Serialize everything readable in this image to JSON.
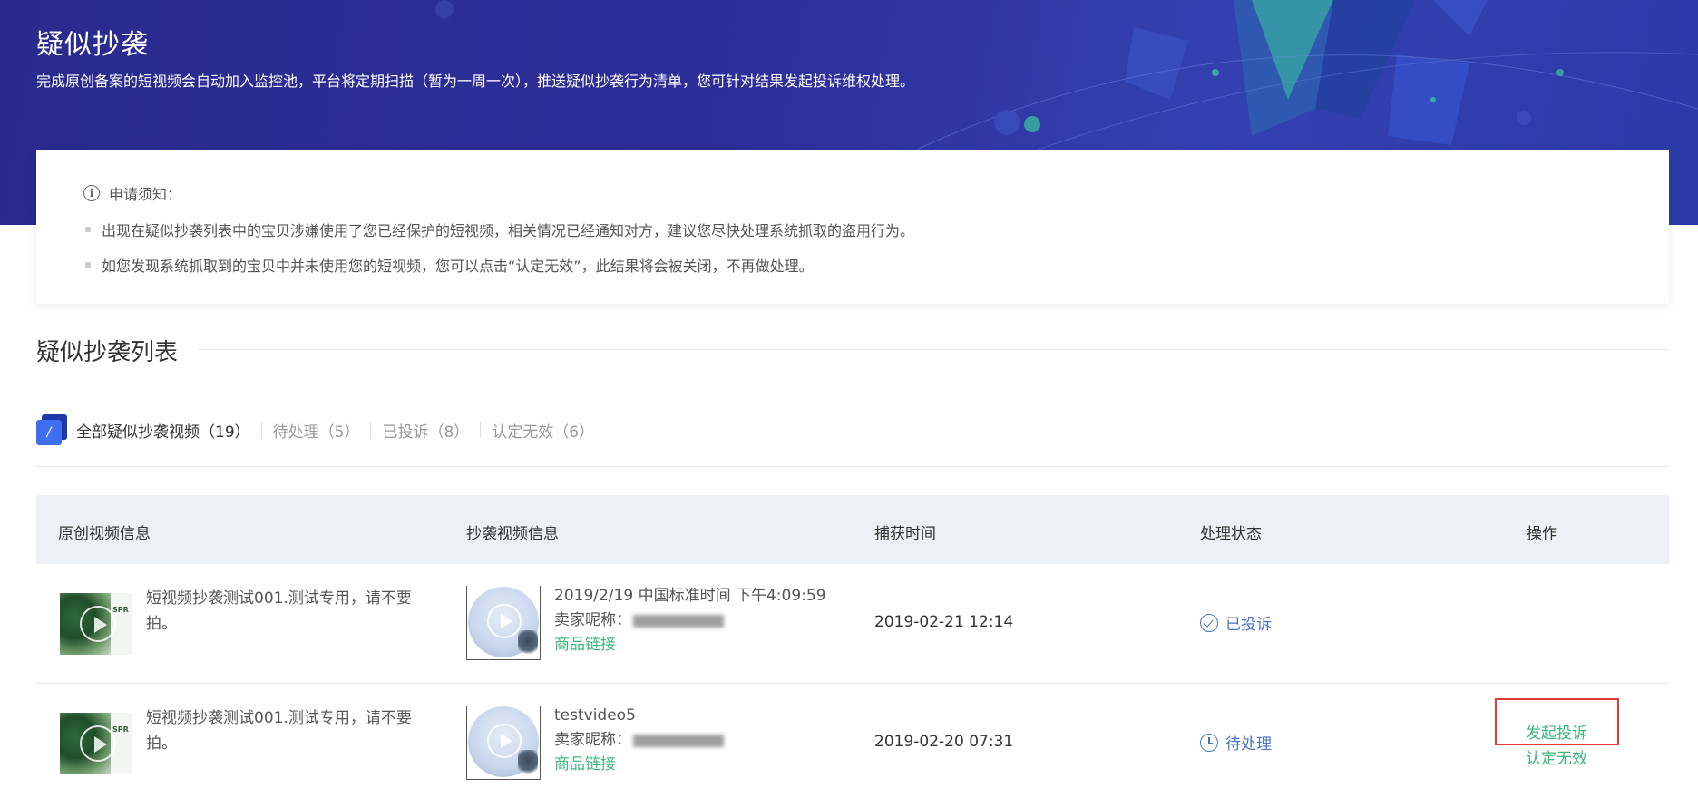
{
  "banner": {
    "title": "疑似抄袭",
    "description": "完成原创备案的短视频会自动加入监控池，平台将定期扫描（暂为一周一次），推送疑似抄袭行为清单，您可针对结果发起投诉维权处理。"
  },
  "notice": {
    "heading": "申请须知：",
    "icon": "info-icon",
    "items": [
      "出现在疑似抄袭列表中的宝贝涉嫌使用了您已经保护的短视频，相关情况已经通知对方，建议您尽快处理系统抓取的盗用行为。",
      "如您发现系统抓取到的宝贝中并未使用您的短视频，您可以点击“认定无效”，此结果将会被关闭，不再做处理。"
    ]
  },
  "section": {
    "title": "疑似抄袭列表"
  },
  "tabs": [
    {
      "label": "全部疑似抄袭视频（19）",
      "active": true
    },
    {
      "label": "待处理（5）",
      "active": false
    },
    {
      "label": "已投诉（8）",
      "active": false
    },
    {
      "label": "认定无效（6）",
      "active": false
    }
  ],
  "table": {
    "headers": [
      "原创视频信息",
      "抄袭视频信息",
      "捕获时间",
      "处理状态",
      "操作"
    ],
    "rows": [
      {
        "original_title": "短视频抄袭测试001.测试专用，请不要拍。",
        "copy_title": "2019/2/19 中国标准时间 下午4:09:59",
        "seller_label": "卖家昵称：",
        "product_link": "商品链接",
        "capture_time": "2019-02-21 12:14",
        "status": "已投诉",
        "status_icon": "check-circle-icon",
        "actions": []
      },
      {
        "original_title": "短视频抄袭测试001.测试专用，请不要拍。",
        "copy_title": "testvideo5",
        "seller_label": "卖家昵称：",
        "product_link": "商品链接",
        "capture_time": "2019-02-20 07:31",
        "status": "待处理",
        "status_icon": "clock-icon",
        "actions": [
          "发起投诉",
          "认定无效"
        ]
      }
    ]
  },
  "colors": {
    "banner": "#2d2f9a",
    "link_green": "#3bb87a",
    "status_blue": "#4a72c4",
    "highlight_red": "#e53935",
    "tab_icon_blue": "#3d6ff0"
  }
}
